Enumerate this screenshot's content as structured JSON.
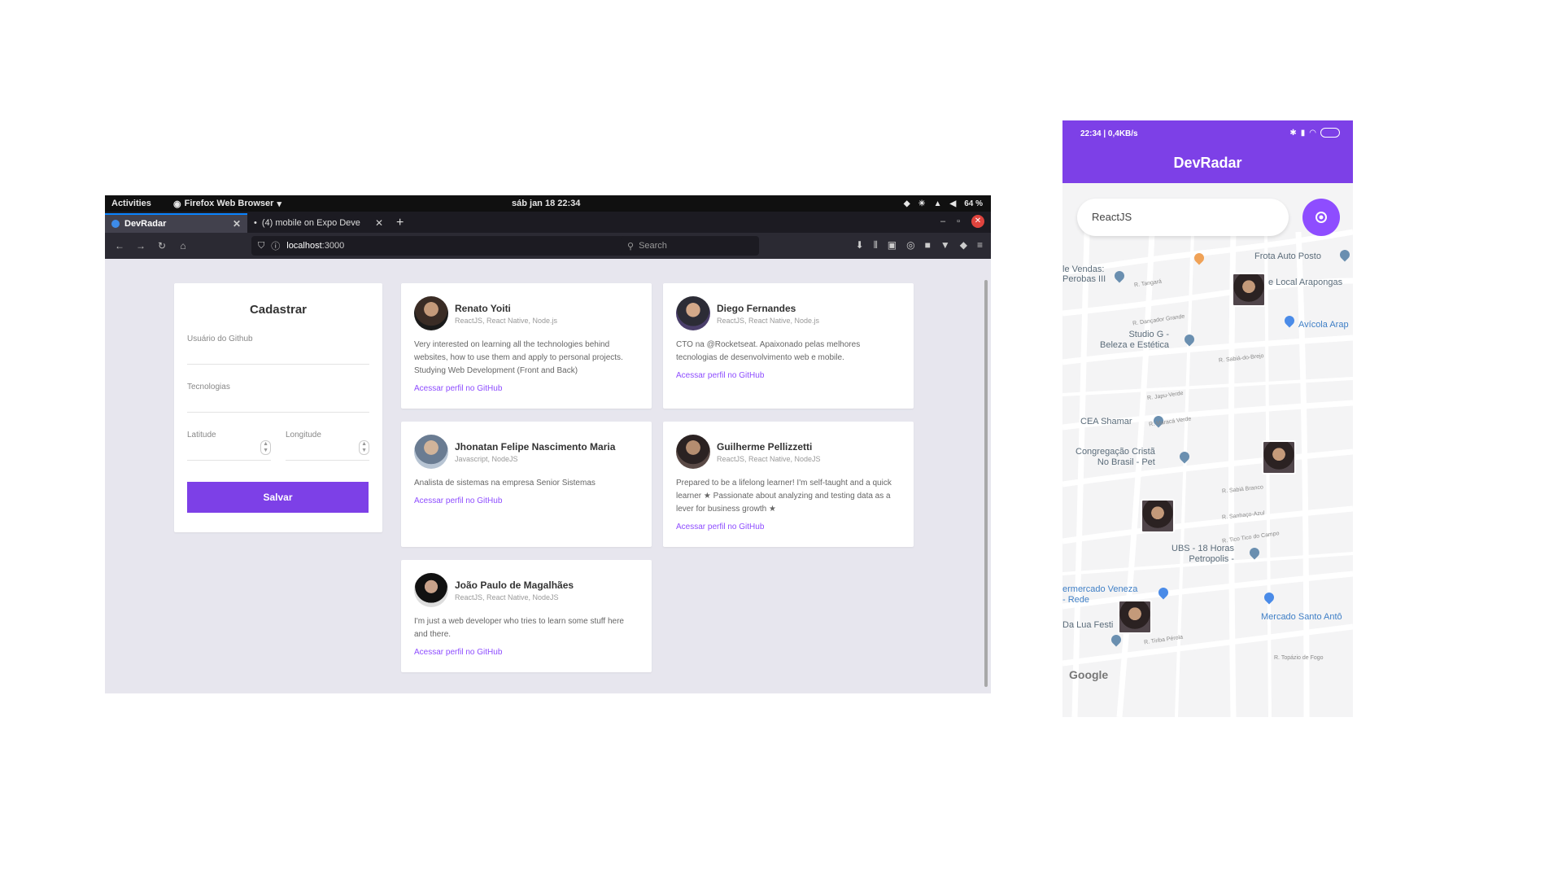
{
  "desktop": {
    "topbar": {
      "activities": "Activities",
      "app_menu": "Firefox Web Browser",
      "clock": "sáb jan 18  22:34",
      "battery": "64 %"
    },
    "tabs": [
      {
        "label": "DevRadar"
      },
      {
        "label": "(4) mobile on Expo Deve"
      }
    ],
    "urlbar": {
      "url_host": "localhost",
      "url_port": ":3000"
    },
    "search_placeholder": "Search",
    "form": {
      "title": "Cadastrar",
      "github_label": "Usuário do Github",
      "techs_label": "Tecnologias",
      "latitude_label": "Latitude",
      "longitude_label": "Longitude",
      "save_label": "Salvar"
    },
    "devs": [
      {
        "name": "Renato Yoiti",
        "techs": "ReactJS, React Native, Node.js",
        "bio": "Very interested on learning all the technologies behind websites, how to use them and apply to personal projects. Studying Web Development (Front and Back)",
        "link": "Acessar perfil no GitHub"
      },
      {
        "name": "Diego Fernandes",
        "techs": "ReactJS, React Native, Node.js",
        "bio": "CTO na @Rocketseat. Apaixonado pelas melhores tecnologias de desenvolvimento web e mobile.",
        "link": "Acessar perfil no GitHub"
      },
      {
        "name": "Jhonatan Felipe Nascimento Maria",
        "techs": "Javascript, NodeJS",
        "bio": "Analista de sistemas na empresa Senior Sistemas",
        "link": "Acessar perfil no GitHub"
      },
      {
        "name": "Guilherme Pellizzetti",
        "techs": "ReactJS, React Native, NodeJS",
        "bio": "Prepared to be a lifelong learner! I'm self-taught and a quick learner ★ Passionate about analyzing and testing data as a lever for business growth ★",
        "link": "Acessar perfil no GitHub"
      },
      {
        "name": "João Paulo de Magalhães",
        "techs": "ReactJS, React Native, NodeJS",
        "bio": "I'm just a web developer who tries to learn some stuff here and there.",
        "link": "Acessar perfil no GitHub"
      }
    ]
  },
  "phone": {
    "status_left": "22:34 | 0,4KB/s",
    "title": "DevRadar",
    "search_value": "ReactJS",
    "places": {
      "frota": "Frota Auto Posto",
      "vendas": "le Vendas:\nPerobas III",
      "local": "e Local Arapongas",
      "avicola": "Avícola Arap",
      "studio": "Studio G -\nBeleza e Estética",
      "cea": "CEA Shamar",
      "congregacao": "Congregação Cristã\nNo Brasil - Pet",
      "ubs": "UBS - 18 Horas\nPetropolis -",
      "mercado1": "ermercado Veneza\n- Rede",
      "mercado2": "Mercado Santo Antô",
      "lua": "Da Lua Festi"
    },
    "streets": {
      "s1": "R. Tangará",
      "s2": "R. Dançador Grande",
      "s3": "R. Sabiá-do-Brejo",
      "s4": "R. Japu-Verde",
      "s5": "R. Maracá Verde",
      "s6": "R. Sabiá Branco",
      "s7": "R. Sanhaço-Azul",
      "s8": "R. Tico Tico do Campo",
      "s9": "R. Tiriba Pérola",
      "s10": "R. Topázio de Fogo"
    },
    "google": "Google"
  }
}
